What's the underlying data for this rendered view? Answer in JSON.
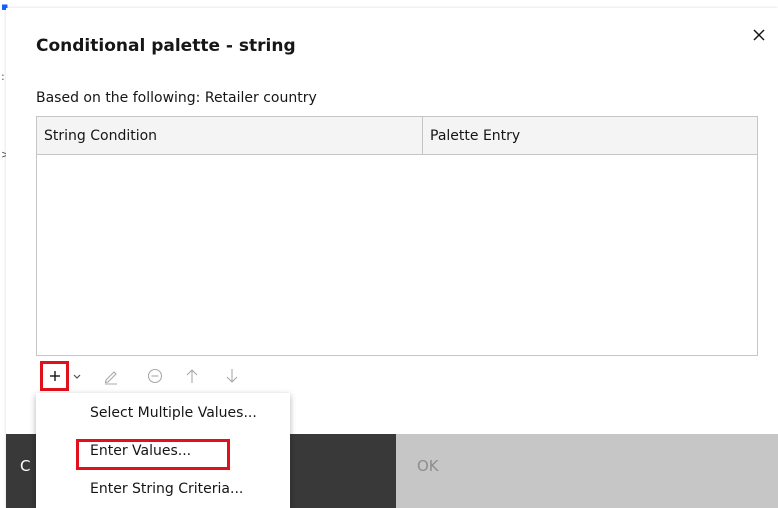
{
  "dialog": {
    "title": "Conditional palette - string",
    "subtitle": "Based on the following: Retailer country"
  },
  "table": {
    "columns": [
      "String Condition",
      "Palette Entry"
    ],
    "rows": []
  },
  "toolbar": {
    "add_icon": "plus-icon",
    "dropdown_icon": "chevron-down-icon",
    "edit_icon": "pencil-icon",
    "remove_icon": "minus-circle-icon",
    "up_icon": "arrow-up-icon",
    "down_icon": "arrow-down-icon"
  },
  "menu": {
    "items": [
      "Select Multiple Values...",
      "Enter Values...",
      "Enter String Criteria..."
    ]
  },
  "footer": {
    "cancel_label": "C",
    "ok_label": "OK"
  },
  "colors": {
    "highlight": "#e0101c",
    "footer_dark": "#393939",
    "footer_disabled": "#c6c6c6"
  }
}
